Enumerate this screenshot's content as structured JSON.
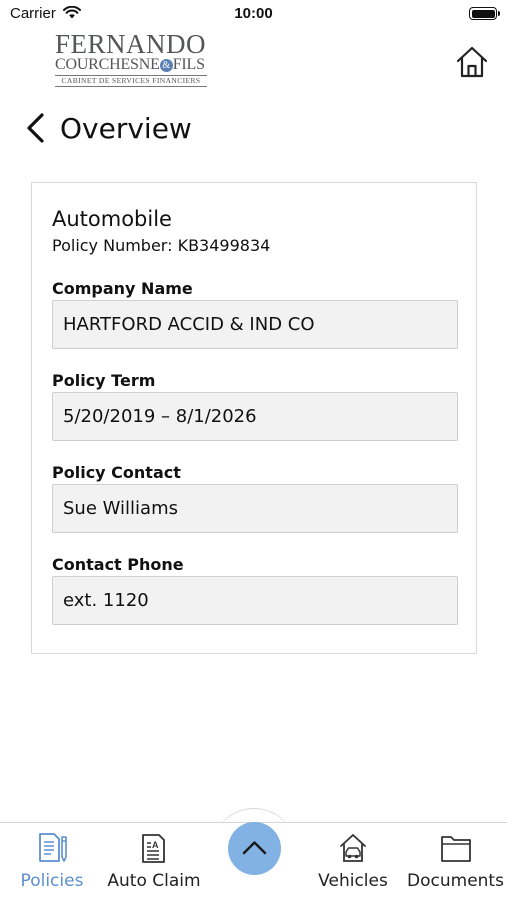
{
  "status_bar": {
    "carrier": "Carrier",
    "time": "10:00"
  },
  "logo": {
    "line1": "FERNANDO",
    "line2a": "COURCHESNE",
    "line2amp": "&",
    "line2b": "FILS",
    "line3": "CABINET DE SERVICES FINANCIERS"
  },
  "header": {
    "title": "Overview"
  },
  "policy": {
    "type": "Automobile",
    "number_line": "Policy Number: KB3499834",
    "fields": [
      {
        "label": "Company Name",
        "value": "HARTFORD ACCID & IND CO"
      },
      {
        "label": "Policy Term",
        "value": "5/20/2019 – 8/1/2026"
      },
      {
        "label": "Policy Contact",
        "value": "Sue Williams"
      },
      {
        "label": "Contact Phone",
        "value": "ext. 1120"
      }
    ]
  },
  "tabs": [
    {
      "label": "Policies",
      "icon": "policies-icon",
      "active": true
    },
    {
      "label": "Auto Claim",
      "icon": "auto-claim-icon",
      "active": false
    },
    {
      "label": "Vehicles",
      "icon": "vehicles-icon",
      "active": false
    },
    {
      "label": "Documents",
      "icon": "documents-icon",
      "active": false
    }
  ],
  "colors": {
    "accent": "#5b8fcf",
    "fab": "#82b1e3",
    "field_bg": "#f2f2f2"
  }
}
